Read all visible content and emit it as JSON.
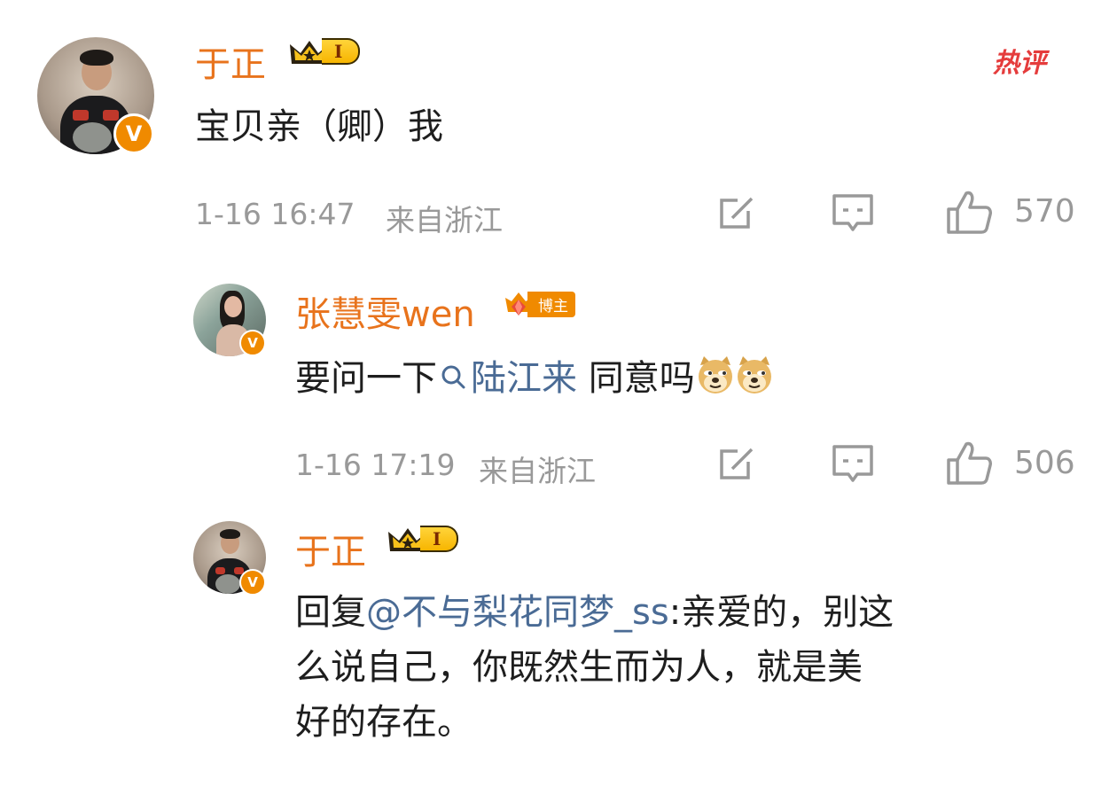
{
  "hot_label": "热评",
  "comments": [
    {
      "author": "于正",
      "level": "I",
      "text": "宝贝亲（卿）我",
      "time": "1-16 16:47",
      "location": "来自浙江",
      "likes": "570"
    },
    {
      "author": "张慧雯wen",
      "badge": "博主",
      "text_before": "要问一下",
      "mention": "陆江来",
      "text_after": " 同意吗",
      "emoji": [
        "doge-emoji",
        "doge-emoji"
      ],
      "time": "1-16 17:19",
      "location": "来自浙江",
      "likes": "506"
    },
    {
      "author": "于正",
      "level": "I",
      "reply_prefix": "回复",
      "reply_to": "@不与梨花同梦_ss",
      "text_line1": ":亲爱的，别这",
      "text_line2": "么说自己，你既然生而为人，就是美",
      "text_line3": "好的存在。"
    }
  ],
  "colors": {
    "name": "#e8731c",
    "link": "#4a6b95",
    "meta": "#999999",
    "hot": "#e53c3c"
  },
  "icons": [
    "share-icon",
    "comment-icon",
    "like-icon",
    "search-icon",
    "verified-badge-icon",
    "crown-icon",
    "gem-icon"
  ]
}
